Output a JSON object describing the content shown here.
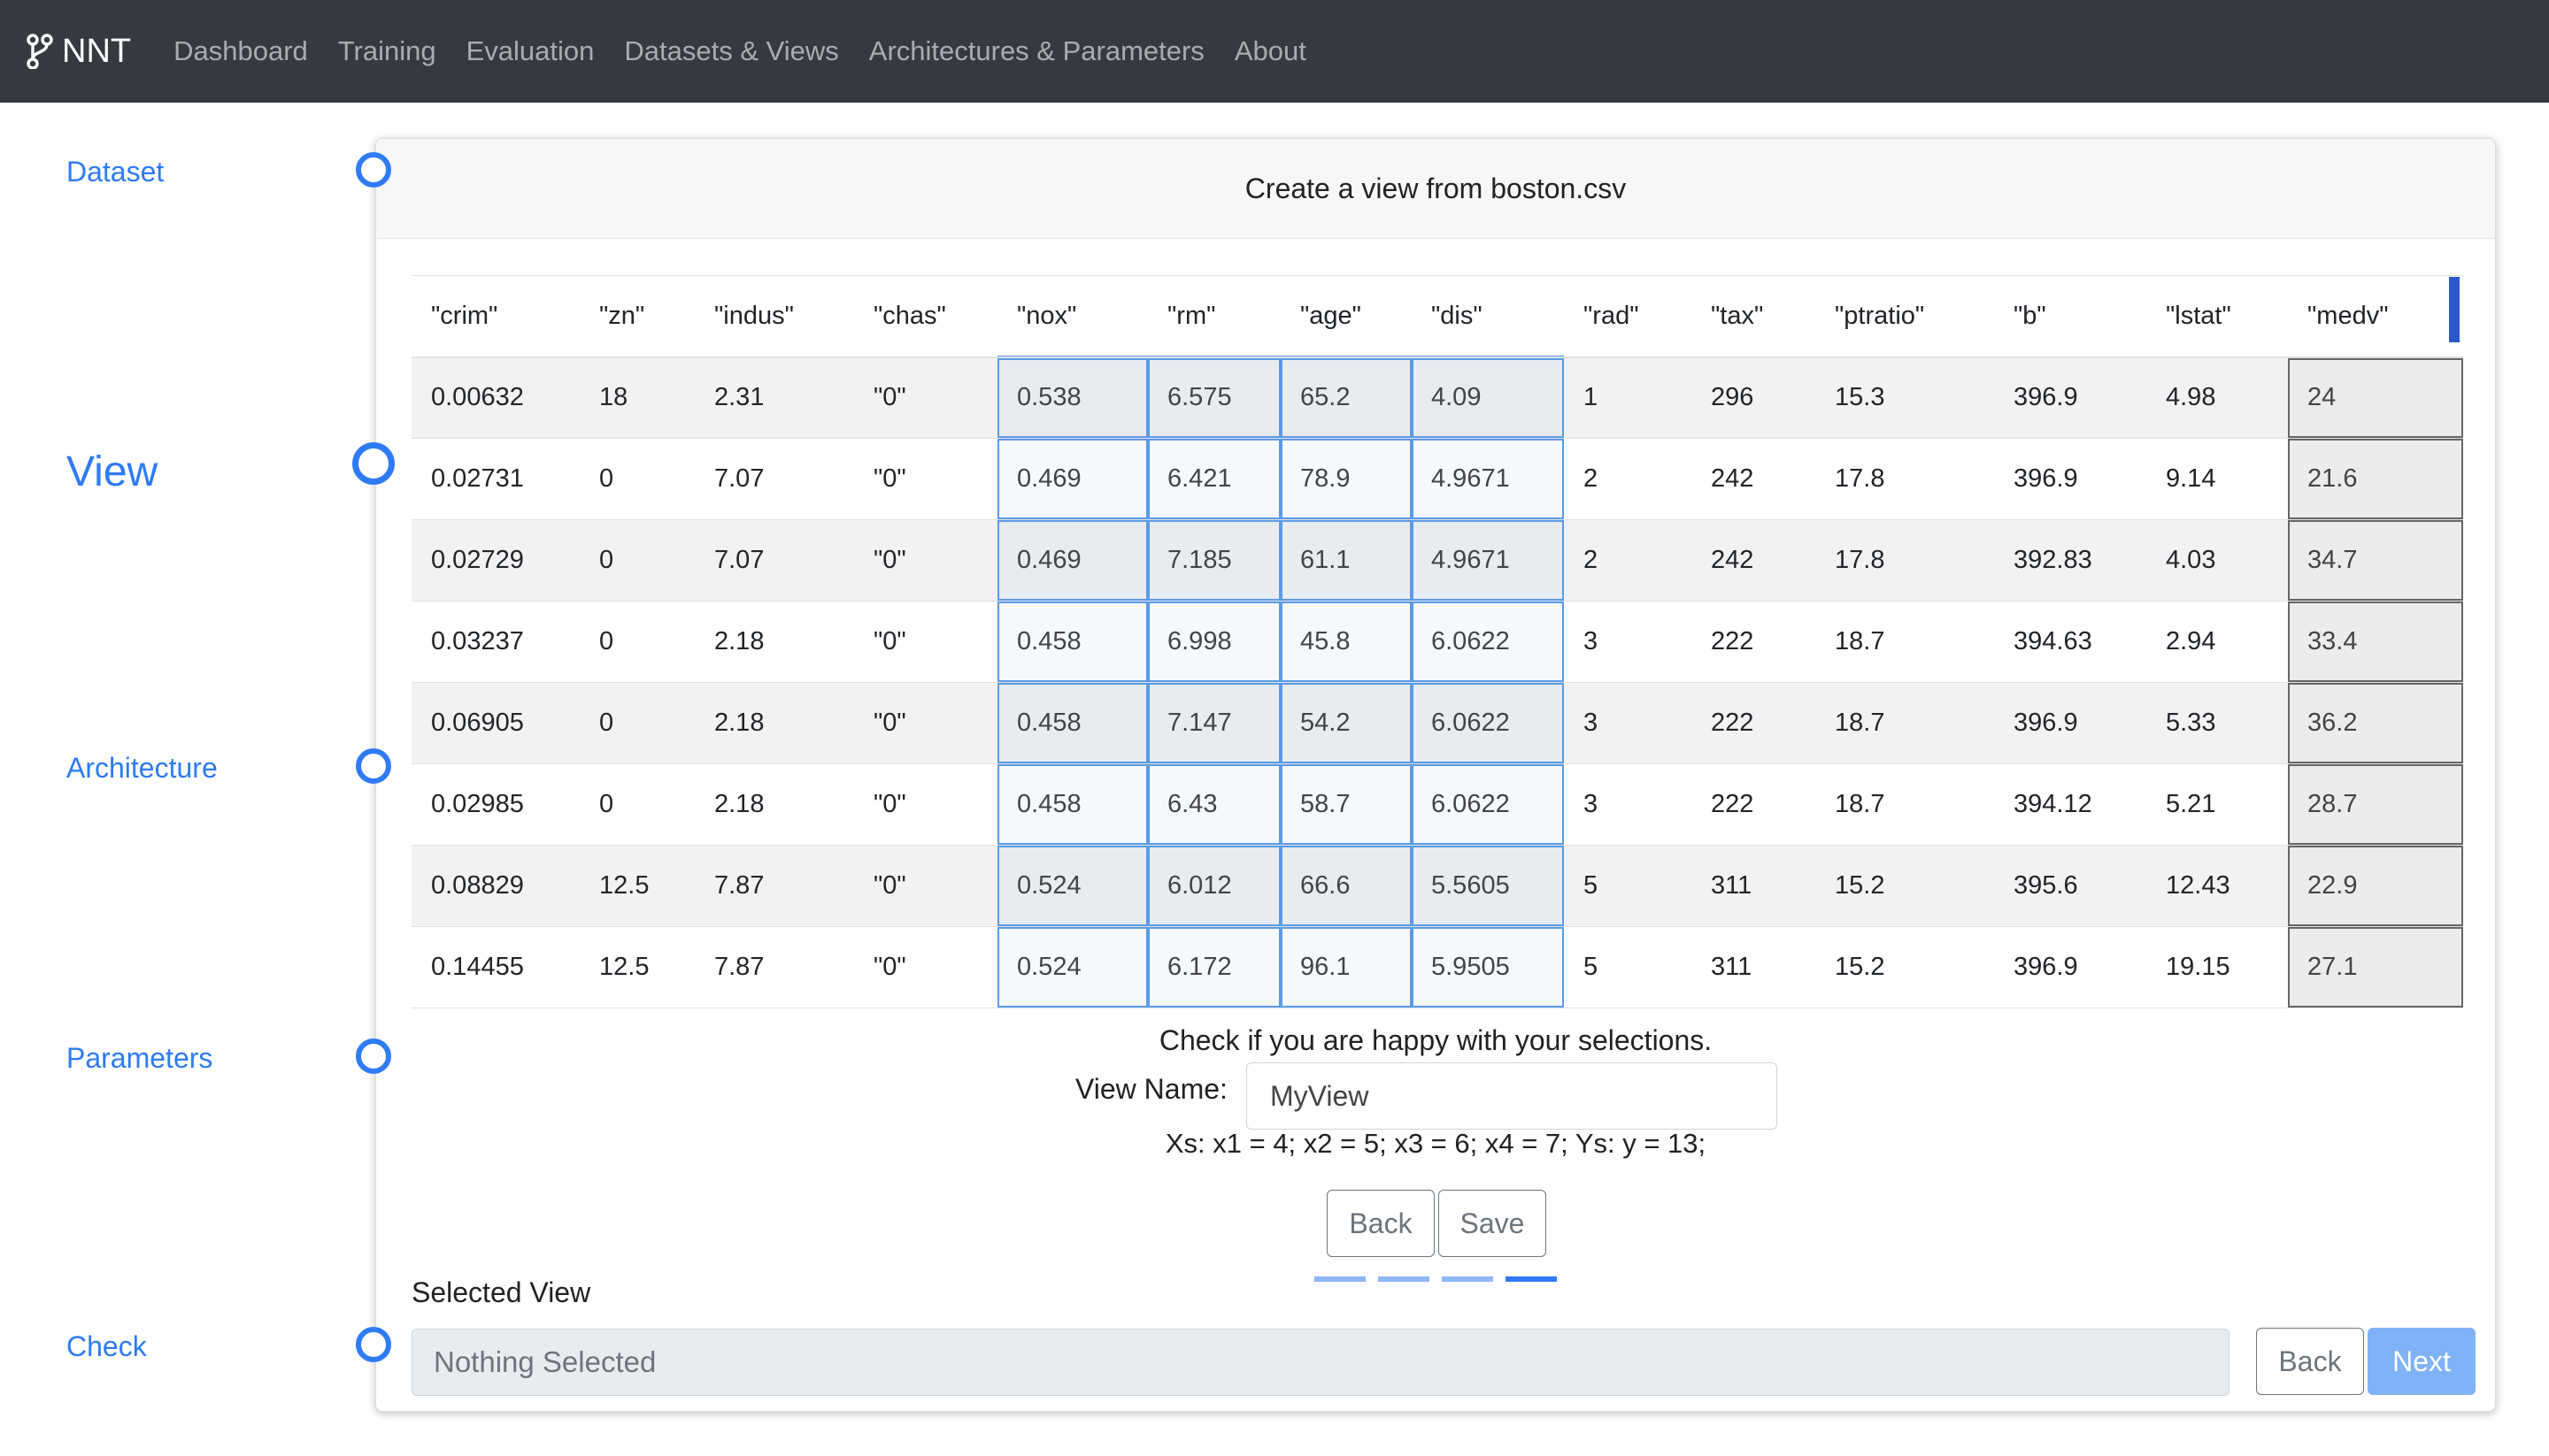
{
  "nav": {
    "brand": "NNT",
    "brand_icon": "git-branch-icon",
    "links": [
      "Dashboard",
      "Training",
      "Evaluation",
      "Datasets & Views",
      "Architectures & Parameters",
      "About"
    ]
  },
  "steps": [
    {
      "label": "Dataset"
    },
    {
      "label": "View"
    },
    {
      "label": "Architecture"
    },
    {
      "label": "Parameters"
    },
    {
      "label": "Check"
    }
  ],
  "card": {
    "title": "Create a view from boston.csv"
  },
  "table": {
    "headers": [
      "\"crim\"",
      "\"zn\"",
      "\"indus\"",
      "\"chas\"",
      "\"nox\"",
      "\"rm\"",
      "\"age\"",
      "\"dis\"",
      "\"rad\"",
      "\"tax\"",
      "\"ptratio\"",
      "\"b\"",
      "\"lstat\"",
      "\"medv\""
    ],
    "rows": [
      [
        "0.00632",
        "18",
        "2.31",
        "\"0\"",
        "0.538",
        "6.575",
        "65.2",
        "4.09",
        "1",
        "296",
        "15.3",
        "396.9",
        "4.98",
        "24"
      ],
      [
        "0.02731",
        "0",
        "7.07",
        "\"0\"",
        "0.469",
        "6.421",
        "78.9",
        "4.9671",
        "2",
        "242",
        "17.8",
        "396.9",
        "9.14",
        "21.6"
      ],
      [
        "0.02729",
        "0",
        "7.07",
        "\"0\"",
        "0.469",
        "7.185",
        "61.1",
        "4.9671",
        "2",
        "242",
        "17.8",
        "392.83",
        "4.03",
        "34.7"
      ],
      [
        "0.03237",
        "0",
        "2.18",
        "\"0\"",
        "0.458",
        "6.998",
        "45.8",
        "6.0622",
        "3",
        "222",
        "18.7",
        "394.63",
        "2.94",
        "33.4"
      ],
      [
        "0.06905",
        "0",
        "2.18",
        "\"0\"",
        "0.458",
        "7.147",
        "54.2",
        "6.0622",
        "3",
        "222",
        "18.7",
        "396.9",
        "5.33",
        "36.2"
      ],
      [
        "0.02985",
        "0",
        "2.18",
        "\"0\"",
        "0.458",
        "6.43",
        "58.7",
        "6.0622",
        "3",
        "222",
        "18.7",
        "394.12",
        "5.21",
        "28.7"
      ],
      [
        "0.08829",
        "12.5",
        "7.87",
        "\"0\"",
        "0.524",
        "6.012",
        "66.6",
        "5.5605",
        "5",
        "311",
        "15.2",
        "395.6",
        "12.43",
        "22.9"
      ],
      [
        "0.14455",
        "12.5",
        "7.87",
        "\"0\"",
        "0.524",
        "6.172",
        "96.1",
        "5.9505",
        "5",
        "311",
        "15.2",
        "396.9",
        "19.15",
        "27.1"
      ]
    ]
  },
  "check": {
    "prompt": "Check if you are happy with your selections.",
    "view_name_label": "View Name:",
    "view_name_value": "MyView",
    "summary": "Xs: x1 = 4; x2 = 5; x3 = 6; x4 = 7; Ys: y = 13;",
    "back_label": "Back",
    "save_label": "Save"
  },
  "bottom": {
    "selected_view_label": "Selected View",
    "selected_view_value": "Nothing Selected",
    "back_label": "Back",
    "next_label": "Next"
  },
  "colors": {
    "accent": "#2f7bf5",
    "navbar": "#343a40",
    "next_button": "#7fb2f6",
    "x_selection": "#5b9ae6",
    "y_selection": "#666666"
  }
}
